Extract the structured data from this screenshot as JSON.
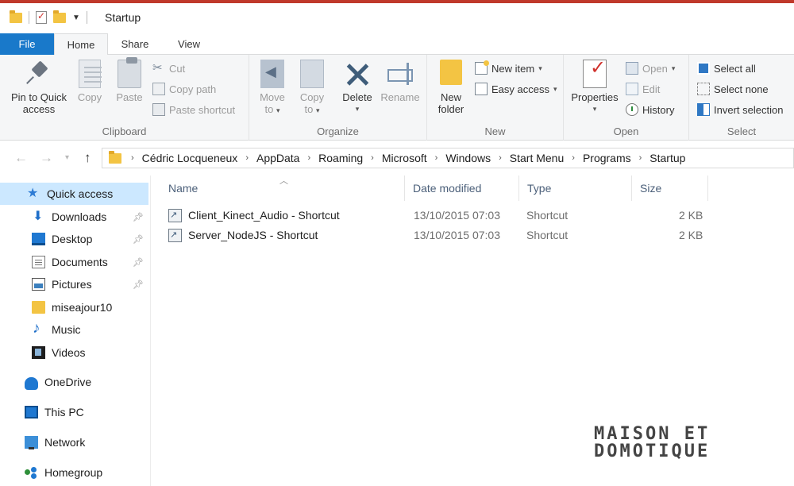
{
  "window": {
    "title": "Startup"
  },
  "tabs": [
    {
      "label": "File"
    },
    {
      "label": "Home"
    },
    {
      "label": "Share"
    },
    {
      "label": "View"
    }
  ],
  "ribbon": {
    "clipboard": {
      "label": "Clipboard",
      "pin_line1": "Pin to Quick",
      "pin_line2": "access",
      "copy": "Copy",
      "paste": "Paste",
      "cut": "Cut",
      "copy_path": "Copy path",
      "paste_shortcut": "Paste shortcut"
    },
    "organize": {
      "label": "Organize",
      "move_to_line1": "Move",
      "move_to_line2": "to",
      "copy_to_line1": "Copy",
      "copy_to_line2": "to",
      "delete": "Delete",
      "rename": "Rename"
    },
    "new": {
      "label": "New",
      "new_folder_line1": "New",
      "new_folder_line2": "folder",
      "new_item": "New item",
      "easy_access": "Easy access"
    },
    "open": {
      "label": "Open",
      "properties": "Properties",
      "open": "Open",
      "edit": "Edit",
      "history": "History"
    },
    "select": {
      "label": "Select",
      "select_all": "Select all",
      "select_none": "Select none",
      "invert_selection": "Invert selection"
    }
  },
  "address": {
    "crumbs": [
      "Cédric Locqueneux",
      "AppData",
      "Roaming",
      "Microsoft",
      "Windows",
      "Start Menu",
      "Programs",
      "Startup"
    ]
  },
  "nav": {
    "items": [
      {
        "label": "Quick access"
      },
      {
        "label": "Downloads"
      },
      {
        "label": "Desktop"
      },
      {
        "label": "Documents"
      },
      {
        "label": "Pictures"
      },
      {
        "label": "miseajour10"
      },
      {
        "label": "Music"
      },
      {
        "label": "Videos"
      },
      {
        "label": "OneDrive"
      },
      {
        "label": "This PC"
      },
      {
        "label": "Network"
      },
      {
        "label": "Homegroup"
      }
    ]
  },
  "columns": {
    "name": "Name",
    "date": "Date modified",
    "type": "Type",
    "size": "Size"
  },
  "files": [
    {
      "name": "Client_Kinect_Audio - Shortcut",
      "date": "13/10/2015 07:03",
      "type": "Shortcut",
      "size": "2 KB"
    },
    {
      "name": "Server_NodeJS - Shortcut",
      "date": "13/10/2015 07:03",
      "type": "Shortcut",
      "size": "2 KB"
    }
  ],
  "watermark": {
    "line1": "MAISON ET",
    "line2": "DOMOTIQUE"
  }
}
